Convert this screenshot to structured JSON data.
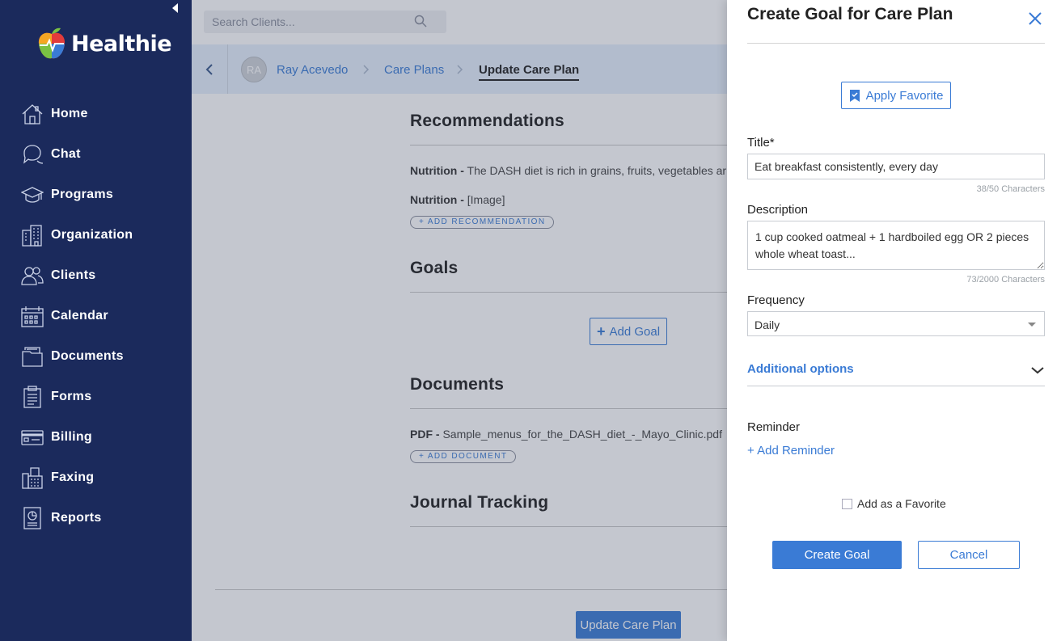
{
  "sidebar": {
    "brand": "Healthie",
    "items": [
      {
        "label": "Home",
        "icon": "home-icon"
      },
      {
        "label": "Chat",
        "icon": "chat-icon"
      },
      {
        "label": "Programs",
        "icon": "graduation-cap-icon"
      },
      {
        "label": "Organization",
        "icon": "building-icon"
      },
      {
        "label": "Clients",
        "icon": "users-icon"
      },
      {
        "label": "Calendar",
        "icon": "calendar-icon"
      },
      {
        "label": "Documents",
        "icon": "folder-icon"
      },
      {
        "label": "Forms",
        "icon": "clipboard-icon"
      },
      {
        "label": "Billing",
        "icon": "credit-card-icon"
      },
      {
        "label": "Faxing",
        "icon": "fax-icon"
      },
      {
        "label": "Reports",
        "icon": "report-icon"
      }
    ]
  },
  "search": {
    "placeholder": "Search Clients..."
  },
  "breadcrumb": {
    "avatar_initials": "RA",
    "client": "Ray Acevedo",
    "care_plans": "Care Plans",
    "current": "Update Care Plan"
  },
  "main": {
    "recommendations": {
      "title": "Recommendations",
      "items": [
        {
          "category": "Nutrition -",
          "text": "The DASH diet is rich in grains, fruits, vegetables ar"
        },
        {
          "category": "Nutrition -",
          "text": "[Image]"
        }
      ],
      "add_label": "+ ADD RECOMMENDATION"
    },
    "goals": {
      "title": "Goals",
      "add_label": "Add Goal"
    },
    "documents": {
      "title": "Documents",
      "items": [
        {
          "category": "PDF -",
          "text": "Sample_menus_for_the_DASH_diet_-_Mayo_Clinic.pdf"
        }
      ],
      "add_label": "+ ADD DOCUMENT"
    },
    "journal": {
      "title": "Journal Tracking"
    },
    "update_button": "Update Care Plan"
  },
  "panel": {
    "title": "Create Goal for Care Plan",
    "apply_favorite": "Apply Favorite",
    "title_label": "Title*",
    "title_value": "Eat breakfast consistently, every day",
    "title_counter": "38/50 Characters",
    "description_label": "Description",
    "description_value": "1 cup cooked oatmeal + 1 hardboiled egg OR 2 pieces whole wheat toast...",
    "description_counter": "73/2000 Characters",
    "frequency_label": "Frequency",
    "frequency_value": "Daily",
    "additional_options": "Additional options",
    "reminder_label": "Reminder",
    "add_reminder": "+ Add Reminder",
    "add_favorite": "Add as a Favorite",
    "create_button": "Create Goal",
    "cancel_button": "Cancel"
  },
  "colors": {
    "sidebar": "#1b2a5c",
    "accent": "#3a7bd5",
    "crumbbar": "#e6f0fc"
  }
}
